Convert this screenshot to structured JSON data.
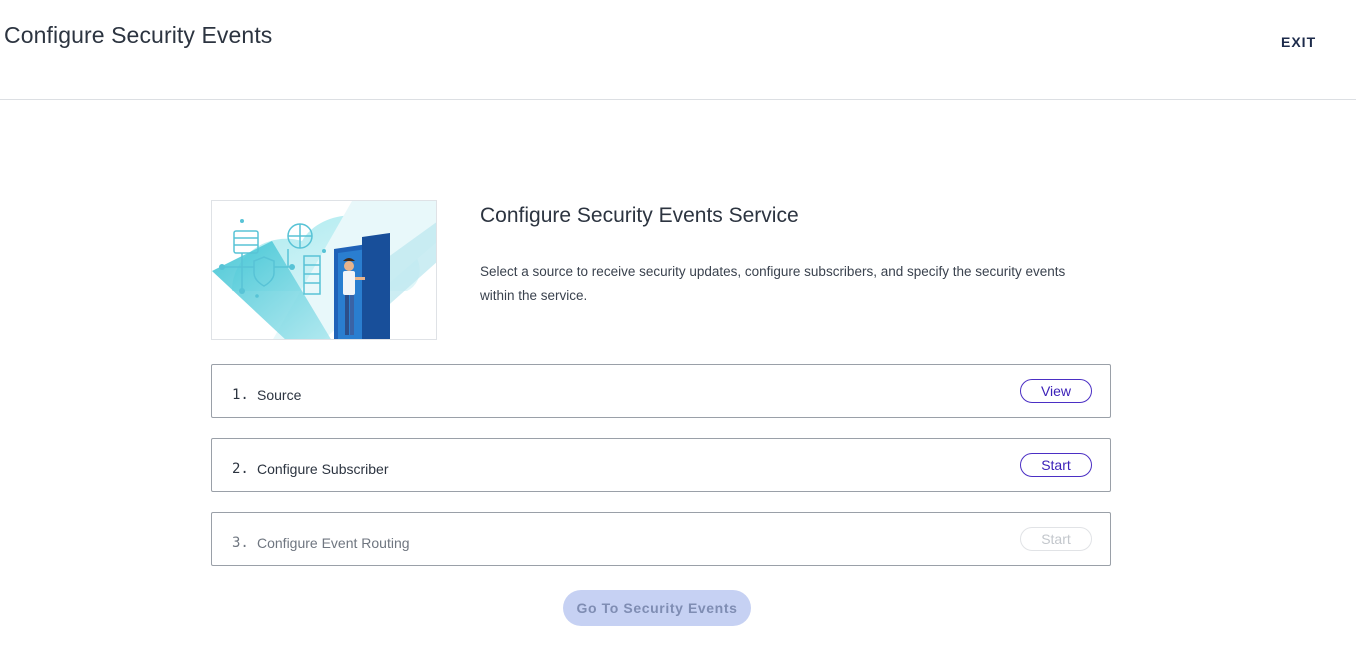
{
  "header": {
    "title": "Configure Security Events",
    "exit_label": "EXIT"
  },
  "hero": {
    "title": "Configure Security Events Service",
    "description": "Select a source to receive security updates, configure subscribers, and specify the security events within the service."
  },
  "steps": [
    {
      "number": "1.",
      "label": "Source",
      "button_label": "View",
      "enabled": true
    },
    {
      "number": "2.",
      "label": "Configure Subscriber",
      "button_label": "Start",
      "enabled": true
    },
    {
      "number": "3.",
      "label": "Configure Event Routing",
      "button_label": "Start",
      "enabled": false
    }
  ],
  "footer": {
    "go_button_label": "Go To Security Events",
    "go_button_enabled": false
  },
  "colors": {
    "accent": "#4b2fc4",
    "disabled_button_bg": "#c6d1f3",
    "illustration_teal": "#3fc7d6",
    "illustration_blue": "#1f62b8"
  }
}
